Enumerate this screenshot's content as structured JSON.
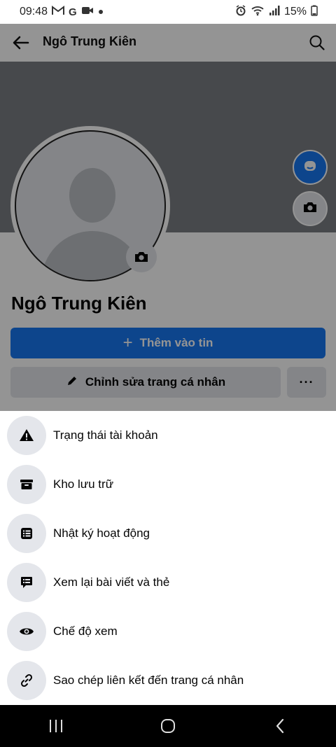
{
  "status_bar": {
    "time": "09:48",
    "left_icons": [
      "gmail-icon",
      "google-icon",
      "video-icon",
      "dot-icon"
    ],
    "right_icons": [
      "alarm-icon",
      "wifi-icon",
      "signal-icon",
      "battery-icon"
    ],
    "battery": "15%"
  },
  "profile": {
    "header_title": "Ngô Trung Kiên",
    "name": "Ngô Trung Kiên",
    "add_story_label": "Thêm vào tin",
    "edit_profile_label": "Chỉnh sửa trang cá nhân",
    "more_label": "···",
    "accent_color": "#1877f2"
  },
  "menu": {
    "items": [
      {
        "label": "Trạng thái tài khoản",
        "icon": "warning-icon"
      },
      {
        "label": "Kho lưu trữ",
        "icon": "archive-icon"
      },
      {
        "label": "Nhật ký hoạt động",
        "icon": "activity-log-icon"
      },
      {
        "label": "Xem lại bài viết và thẻ",
        "icon": "review-posts-icon"
      },
      {
        "label": "Chế độ xem",
        "icon": "eye-icon"
      },
      {
        "label": "Sao chép liên kết đến trang cá nhân",
        "icon": "link-icon"
      }
    ]
  },
  "nav_bar": {
    "icons": [
      "recents-icon",
      "home-icon",
      "back-icon"
    ]
  }
}
